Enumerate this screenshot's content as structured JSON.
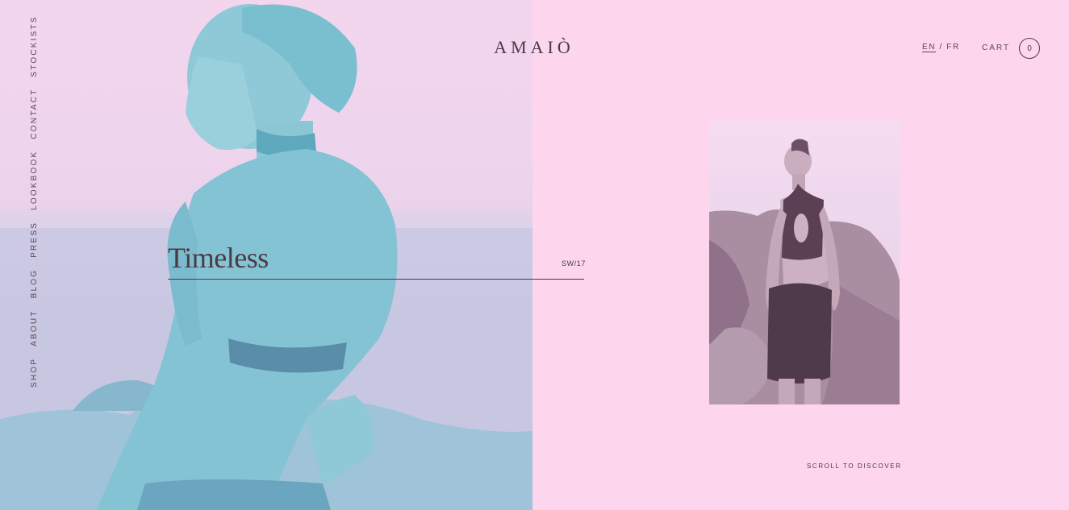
{
  "brand": {
    "logo": "AMAIÒ"
  },
  "nav": {
    "items": [
      {
        "label": "SHOP"
      },
      {
        "label": "ABOUT"
      },
      {
        "label": "BLOG"
      },
      {
        "label": "PRESS"
      },
      {
        "label": "LOOKBOOK"
      },
      {
        "label": "CONTACT"
      },
      {
        "label": "STOCKISTS"
      }
    ]
  },
  "header": {
    "lang_en": "EN",
    "lang_sep": "/",
    "lang_fr": "FR",
    "cart_label": "CART",
    "cart_count": "0"
  },
  "hero": {
    "title": "Timeless",
    "season": "SW/17"
  },
  "footer": {
    "scroll_label": "SCROLL TO DISCOVER"
  },
  "colors": {
    "background": "#fdd6ee",
    "duotone_cyan": "#7cc3d3",
    "text": "#4b3a44"
  }
}
